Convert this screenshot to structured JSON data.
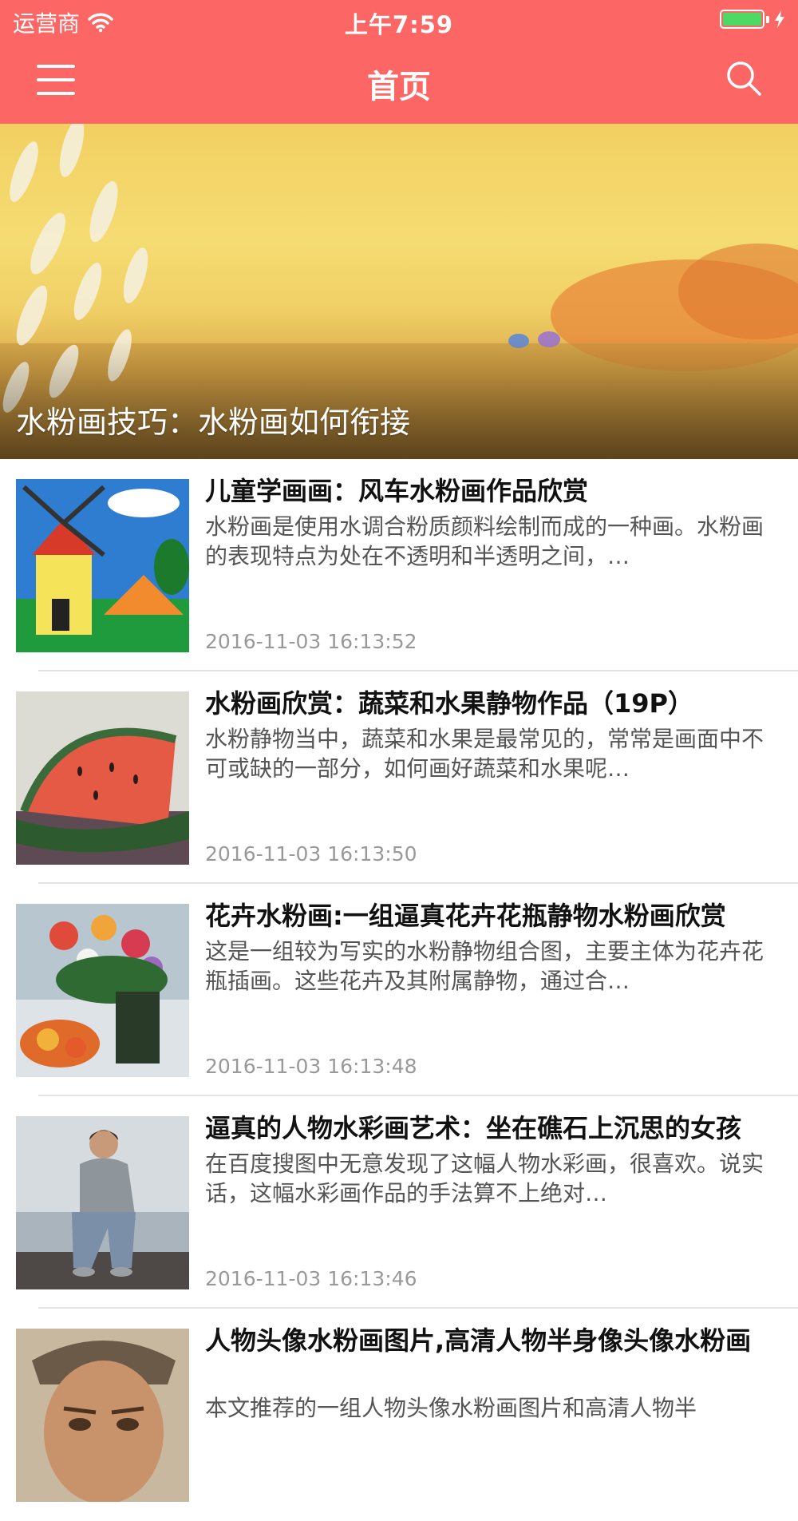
{
  "status_bar": {
    "carrier": "运营商",
    "time": "上午7:59",
    "battery_level": 1.0
  },
  "nav": {
    "title": "首页",
    "menu_icon": "menu-icon",
    "search_icon": "search-icon"
  },
  "hero": {
    "caption": "水粉画技巧：水粉画如何衔接"
  },
  "articles": [
    {
      "title": "儿童学画画：风车水粉画作品欣赏",
      "summary": "水粉画是使用水调合粉质颜料绘制而成的一种画。水粉画的表现特点为处在不透明和半透明之间，…",
      "time": "2016-11-03 16:13:52"
    },
    {
      "title": "水粉画欣赏：蔬菜和水果静物作品（19P）",
      "summary": "水粉静物当中，蔬菜和水果是最常见的，常常是画面中不可或缺的一部分，如何画好蔬菜和水果呢…",
      "time": "2016-11-03 16:13:50"
    },
    {
      "title": "花卉水粉画:一组逼真花卉花瓶静物水粉画欣赏",
      "summary": "这是一组较为写实的水粉静物组合图，主要主体为花卉花瓶插画。这些花卉及其附属静物，通过合…",
      "time": "2016-11-03 16:13:48"
    },
    {
      "title": "逼真的人物水彩画艺术：坐在礁石上沉思的女孩",
      "summary": "在百度搜图中无意发现了这幅人物水彩画，很喜欢。说实话，这幅水彩画作品的手法算不上绝对…",
      "time": "2016-11-03 16:13:46"
    },
    {
      "title": "人物头像水粉画图片,高清人物半身像头像水粉画",
      "summary": "本文推荐的一组人物头像水粉画图片和高清人物半"
    }
  ],
  "colors": {
    "header": "#fc6766",
    "title_text": "#111111",
    "summary_text": "#555555",
    "time_text": "#999999"
  }
}
